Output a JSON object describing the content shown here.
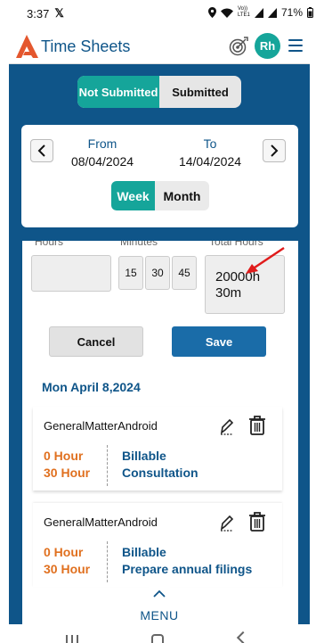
{
  "status_bar": {
    "time": "3:37",
    "x_icon": "𝕏",
    "battery": "71%",
    "volte": "Vo)) LTE1"
  },
  "app_bar": {
    "title": "Time Sheets",
    "avatar_initials": "Rh",
    "brand_color": "#0f5589",
    "accent_color": "#15a59a"
  },
  "status_tabs": {
    "not_submitted": "Not Submitted",
    "submitted": "Submitted",
    "selected": "Not Submitted"
  },
  "date_range": {
    "from_label": "From",
    "from_value": "08/04/2024",
    "to_label": "To",
    "to_value": "14/04/2024",
    "prev_glyph": "<",
    "next_glyph": ">"
  },
  "period_toggle": {
    "week": "Week",
    "month": "Month",
    "selected": "Week"
  },
  "entry_form": {
    "hours_label": "Hours",
    "minutes_label": "Minutes",
    "total_label": "Total Hours",
    "hours_value": "",
    "minute_options": [
      "15",
      "30",
      "45"
    ],
    "total_line1": "20000h",
    "total_line2": "30m",
    "cancel_label": "Cancel",
    "save_label": "Save"
  },
  "day": {
    "title": "Mon April 8,2024",
    "entries": [
      {
        "matter": "GeneralMatterAndroid",
        "hours": "0 Hour",
        "minutes": "30 Hour",
        "billable": "Billable",
        "activity": "Consultation"
      },
      {
        "matter": "GeneralMatterAndroid",
        "hours": "0 Hour",
        "minutes": "30 Hour",
        "billable": "Billable",
        "activity": "Prepare annual filings"
      }
    ]
  },
  "bottom_menu": {
    "label": "MENU"
  }
}
